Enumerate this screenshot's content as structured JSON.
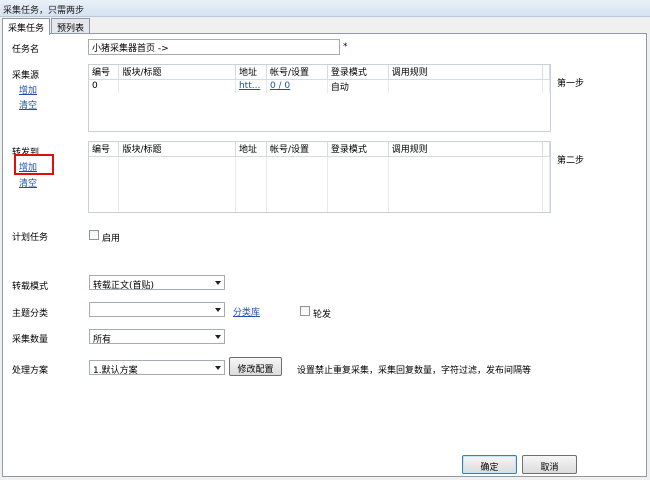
{
  "window": {
    "title": "采集任务，只需两步"
  },
  "tabs": [
    {
      "label": "采集任务",
      "active": true
    },
    {
      "label": "预列表",
      "active": false
    }
  ],
  "task_name": {
    "label": "任务名",
    "value": "小猪采集器首页 ->",
    "required_mark": "*"
  },
  "source": {
    "label": "采集源",
    "add_link": "增加",
    "clear_link": "清空",
    "step": "第一步",
    "columns": [
      "编号",
      "版块/标题",
      "地址",
      "帐号/设置",
      "登录模式",
      "调用规则"
    ],
    "rows": [
      [
        "0",
        "",
        "htt...",
        "0 / 0",
        "自动",
        ""
      ]
    ]
  },
  "repost": {
    "label": "转发到",
    "add_link": "增加",
    "clear_link": "清空",
    "step": "第二步",
    "columns": [
      "编号",
      "版块/标题",
      "地址",
      "帐号/设置",
      "登录模式",
      "调用规则"
    ],
    "rows": []
  },
  "schedule": {
    "label": "计划任务",
    "checkbox_label": "启用",
    "checked": false
  },
  "repost_mode": {
    "label": "转载模式",
    "value": "转载正文(首贴)"
  },
  "topic_category": {
    "label": "主题分类",
    "value": "",
    "link": "分类库",
    "checkbox_label": "轮发",
    "checked": false
  },
  "collect_count": {
    "label": "采集数量",
    "value": "所有"
  },
  "processing": {
    "label": "处理方案",
    "value": "1.默认方案",
    "modify_button": "修改配置",
    "description": "设置禁止重复采集，采集回复数量，字符过滤，发布间隔等"
  },
  "footer": {
    "ok": "确定",
    "cancel": "取消"
  }
}
